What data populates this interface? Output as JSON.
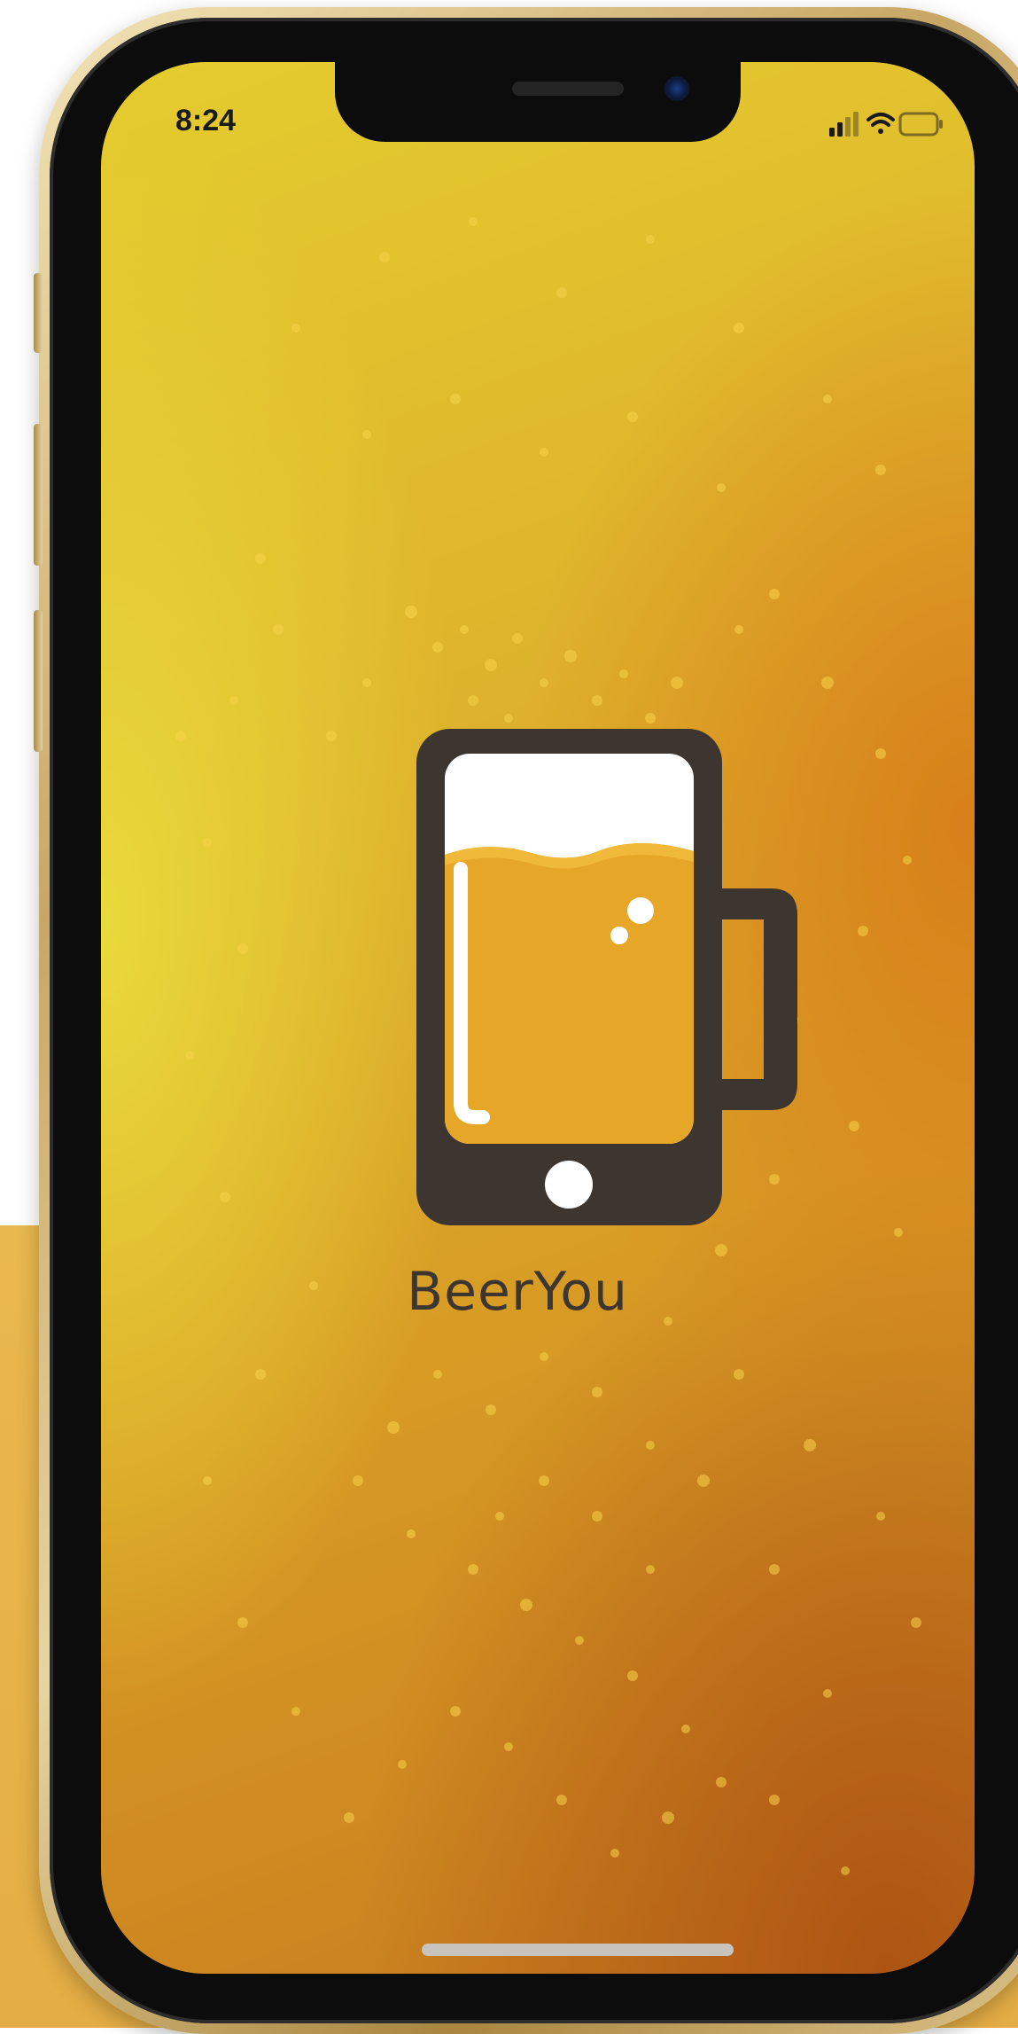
{
  "status_bar": {
    "time": "8:24"
  },
  "app": {
    "name": "BeerYou"
  },
  "colors": {
    "logo_dark": "#3d3530",
    "beer_fill": "#e6a628",
    "foam_white": "#ffffff"
  },
  "icons": [
    "signal-bars-icon",
    "wifi-icon",
    "battery-icon",
    "beer-mug-phone-logo-icon"
  ]
}
